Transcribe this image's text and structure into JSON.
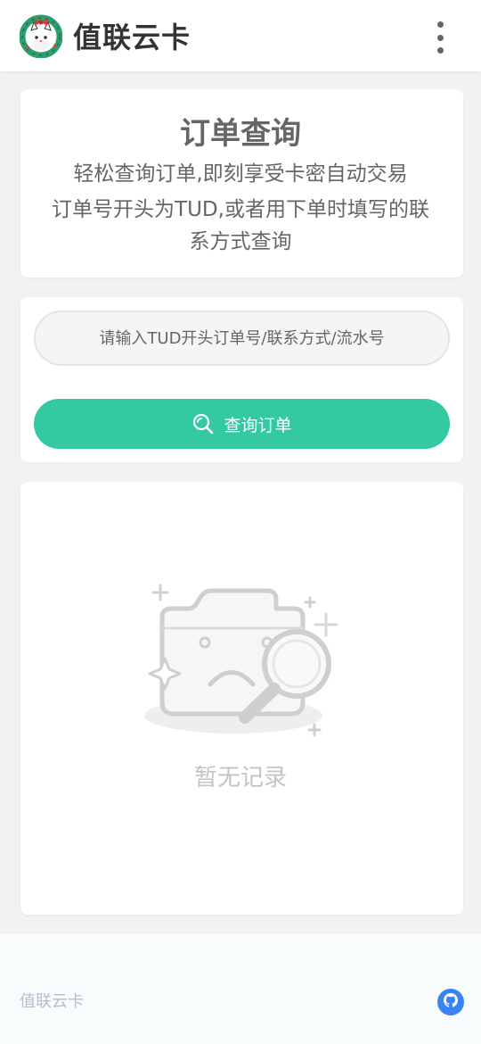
{
  "header": {
    "brand": "值联云卡",
    "logo_icon": "wreath-cat-logo-icon",
    "menu_icon": "more-vertical-icon"
  },
  "intro": {
    "title": "订单查询",
    "line1": "轻松查询订单,即刻享受卡密自动交易",
    "line2": "订单号开头为TUD,或者用下单时填写的联系方式查询"
  },
  "search": {
    "placeholder": "请输入TUD开头订单号/联系方式/流水号",
    "value": "",
    "button_label": "查询订单",
    "button_icon": "search-icon"
  },
  "result": {
    "empty_text": "暂无记录",
    "empty_icon": "empty-folder-magnifier-icon"
  },
  "footer": {
    "text": "值联云卡",
    "github_icon": "github-icon"
  },
  "colors": {
    "accent": "#33c9a2",
    "page_bg": "#f2f2f2",
    "card_bg": "#ffffff",
    "github_blue": "#3b82f6"
  }
}
